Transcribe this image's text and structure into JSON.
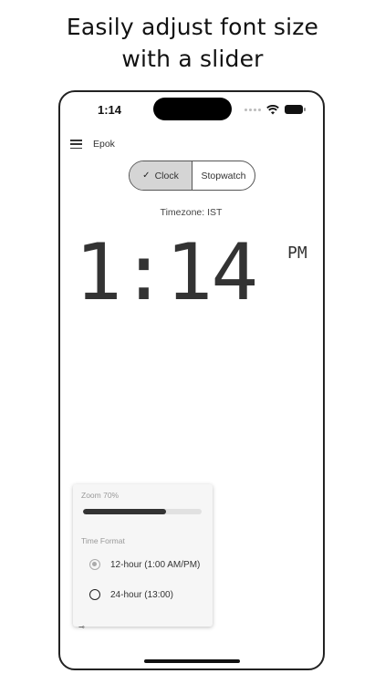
{
  "headline": {
    "line1": "Easily adjust font size",
    "line2": "with a slider"
  },
  "status": {
    "time": "1:14"
  },
  "app": {
    "title": "Epok"
  },
  "tabs": [
    {
      "label": "Clock",
      "active": true
    },
    {
      "label": "Stopwatch",
      "active": false
    }
  ],
  "timezone": "Timezone: IST",
  "clock": {
    "time": "1:14",
    "ampm": "PM"
  },
  "settings": {
    "zoom_label": "Zoom 70%",
    "zoom_value": 0.7,
    "format_label": "Time Format",
    "options": [
      {
        "label": "12-hour (1:00 AM/PM)",
        "selected": true
      },
      {
        "label": "24-hour (13:00)",
        "selected": false
      }
    ]
  },
  "colors": {
    "accent": "#333333",
    "segment_active": "#d5d5d5",
    "panel_bg": "#f6f6f6"
  }
}
